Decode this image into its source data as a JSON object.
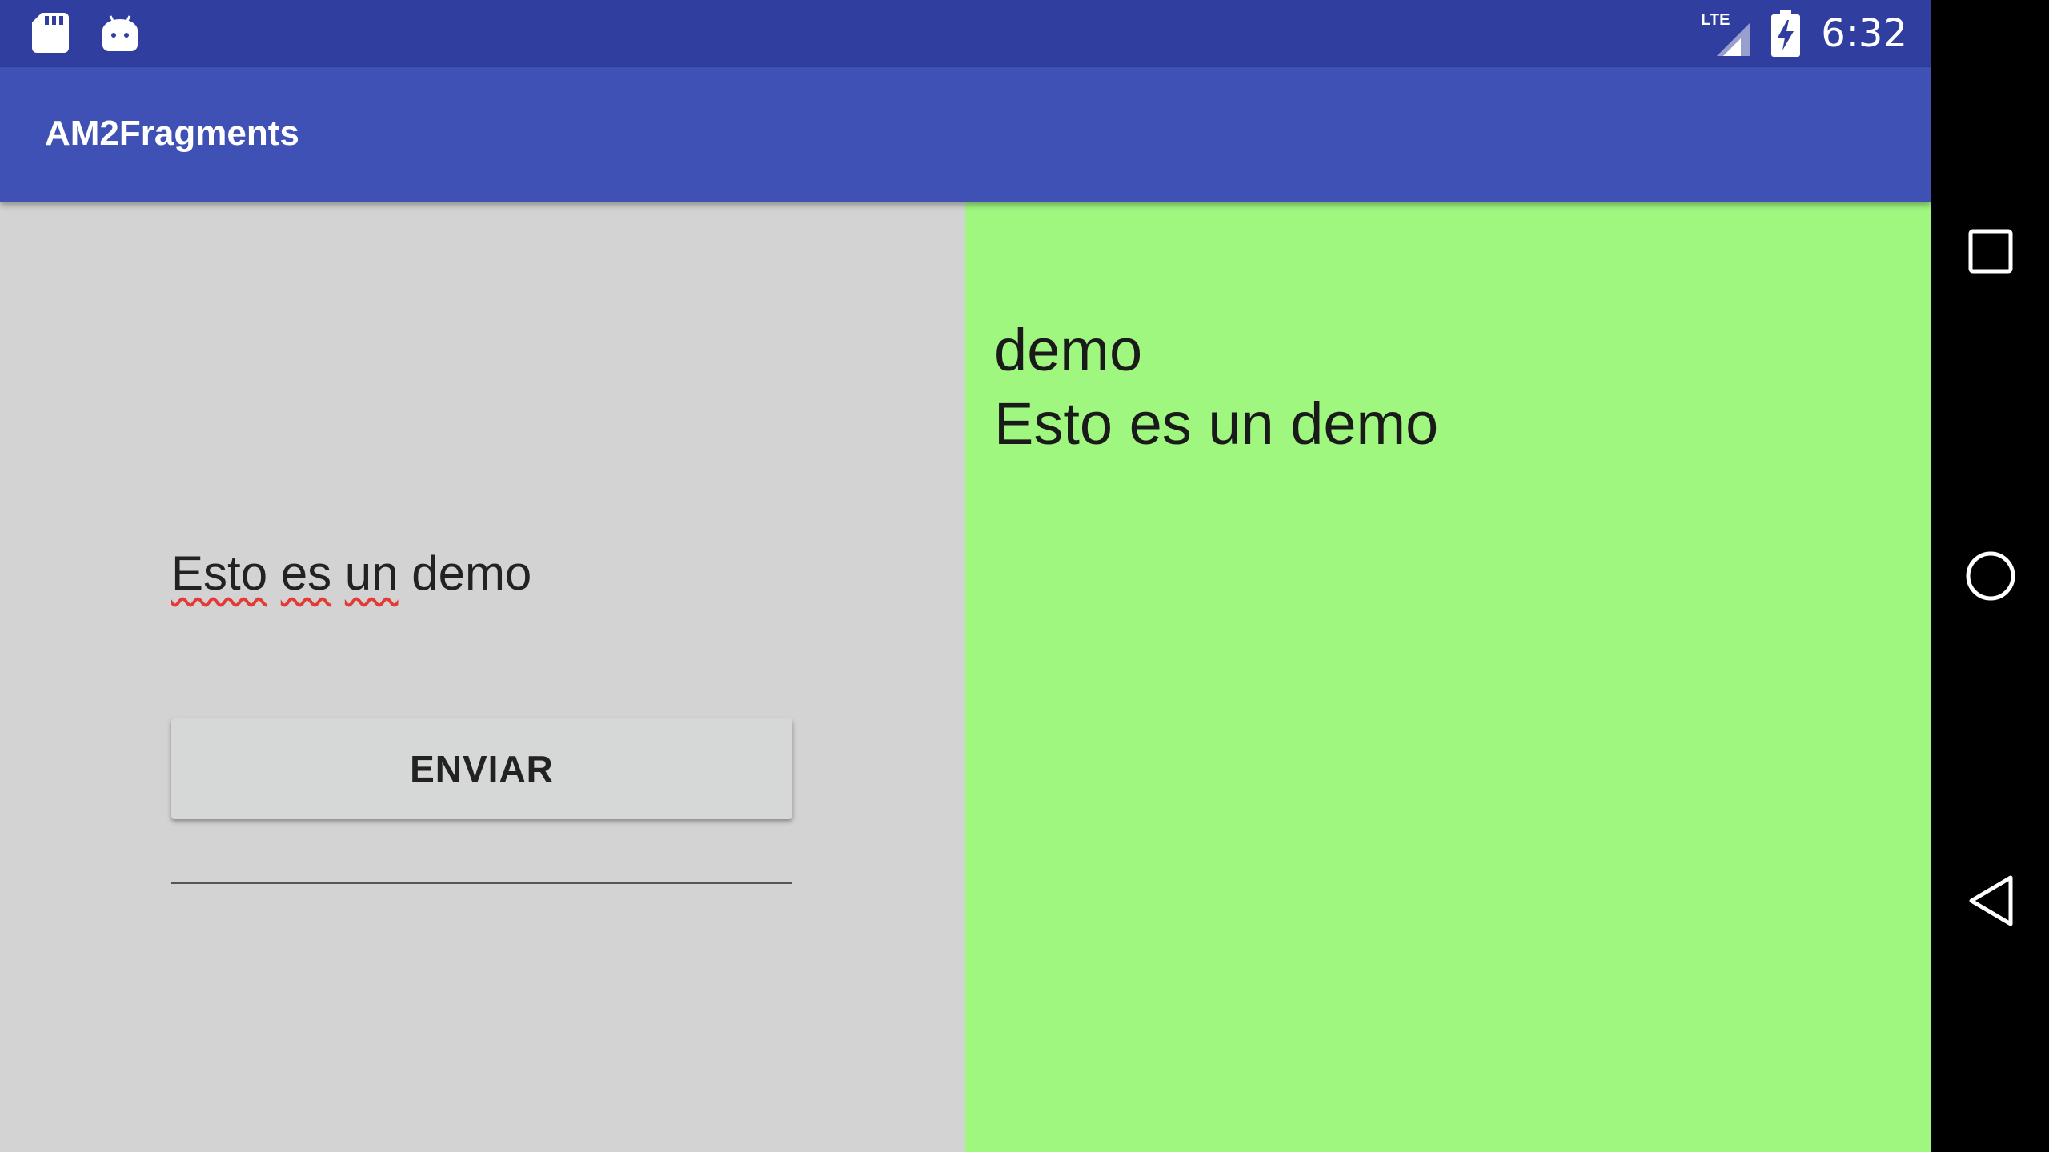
{
  "status_bar": {
    "time": "6:32",
    "network_label": "LTE",
    "left_icons": [
      "sd-card-icon",
      "android-debug-icon"
    ],
    "right_icons": [
      "signal-icon",
      "battery-charging-icon"
    ]
  },
  "app_bar": {
    "title": "AM2Fragments"
  },
  "left_fragment": {
    "input_value": [
      "Esto",
      " ",
      "es",
      " ",
      "un",
      " demo"
    ],
    "send_button_label": "ENVIAR"
  },
  "right_fragment": {
    "line1": "demo",
    "line2": "Esto es un demo"
  },
  "nav_bar": {
    "buttons": [
      "recents-icon",
      "home-icon",
      "back-icon"
    ]
  },
  "colors": {
    "status_bar": "#303f9f",
    "app_bar": "#3f51b5",
    "left_pane": "#d3d3d3",
    "right_pane": "#a0f780",
    "spell_underline": "#e53935"
  }
}
